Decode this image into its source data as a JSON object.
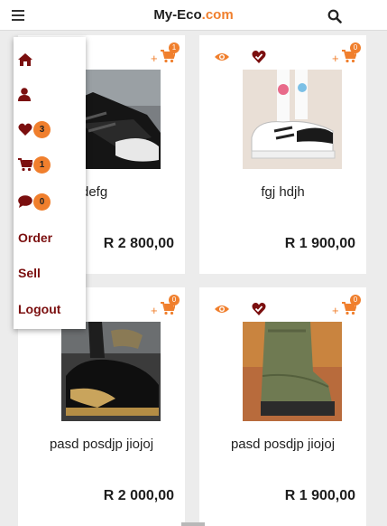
{
  "header": {
    "brand_main": "My-Eco",
    "brand_suffix": ".com"
  },
  "menu": {
    "wishlist_count": "3",
    "cart_count": "1",
    "messages_count": "0",
    "order_label": "Order",
    "sell_label": "Sell",
    "logout_label": "Logout"
  },
  "products": [
    {
      "name": "defg",
      "price": "R 2 800,00",
      "cart_count": "1"
    },
    {
      "name": "fgj hdjh",
      "price": "R 1 900,00",
      "cart_count": "0"
    },
    {
      "name": "pasd posdjp jiojoj",
      "price": "R 2 000,00",
      "cart_count": "0"
    },
    {
      "name": "pasd posdjp jiojoj",
      "price": "R 1 900,00",
      "cart_count": "0"
    }
  ],
  "colors": {
    "accent": "#f07f2d",
    "menu_text": "#7b0f0f",
    "heart": "#7b0f0f"
  },
  "icons": [
    "menu-icon",
    "search-icon",
    "home-icon",
    "user-icon",
    "heart-icon",
    "cart-icon",
    "chat-icon",
    "eye-icon",
    "heart-check-icon",
    "add-to-cart-icon"
  ]
}
